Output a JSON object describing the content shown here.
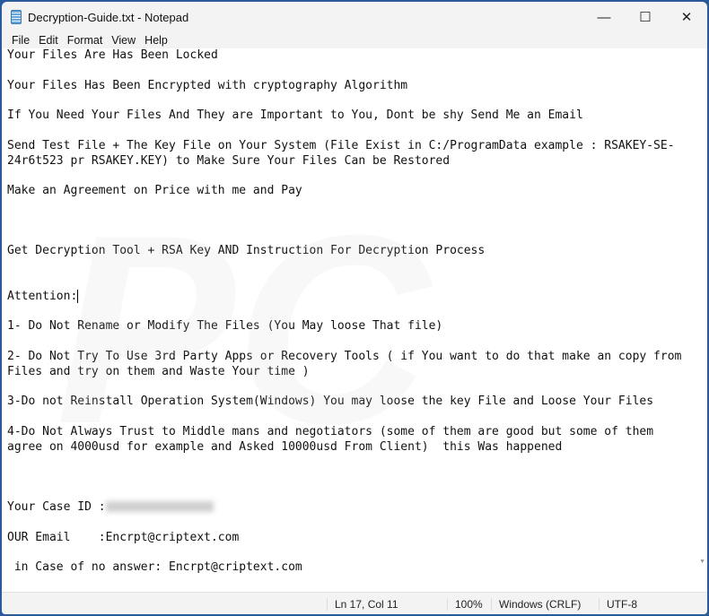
{
  "window": {
    "title": "Decryption-Guide.txt - Notepad",
    "icon": "notepad-icon"
  },
  "menu": [
    "File",
    "Edit",
    "Format",
    "View",
    "Help"
  ],
  "lines": [
    "Your Files Are Has Been Locked",
    "",
    "Your Files Has Been Encrypted with cryptography Algorithm",
    "",
    "If You Need Your Files And They are Important to You, Dont be shy Send Me an Email",
    "",
    "Send Test File + The Key File on Your System (File Exist in C:/ProgramData example : RSAKEY-SE-",
    "24r6t523 pr RSAKEY.KEY) to Make Sure Your Files Can be Restored",
    "",
    "Make an Agreement on Price with me and Pay",
    "",
    "",
    "",
    "Get Decryption Tool + RSA Key AND Instruction For Decryption Process",
    "",
    "",
    "Attention:",
    "",
    "1- Do Not Rename or Modify The Files (You May loose That file)",
    "",
    "2- Do Not Try To Use 3rd Party Apps or Recovery Tools ( if You want to do that make an copy from",
    "Files and try on them and Waste Your time )",
    "",
    "3-Do not Reinstall Operation System(Windows) You may loose the key File and Loose Your Files",
    "",
    "4-Do Not Always Trust to Middle mans and negotiators (some of them are good but some of them",
    "agree on 4000usd for example and Asked 10000usd From Client)  this Was happened",
    "",
    "",
    ""
  ],
  "case_id_label": "Your Case ID :",
  "tail_lines": [
    "",
    "OUR Email    :Encrpt@criptext.com",
    "",
    " in Case of no answer: Encrpt@criptext.com"
  ],
  "status": {
    "position": "Ln 17, Col 11",
    "zoom": "100%",
    "line_ending": "Windows (CRLF)",
    "encoding": "UTF-8"
  }
}
